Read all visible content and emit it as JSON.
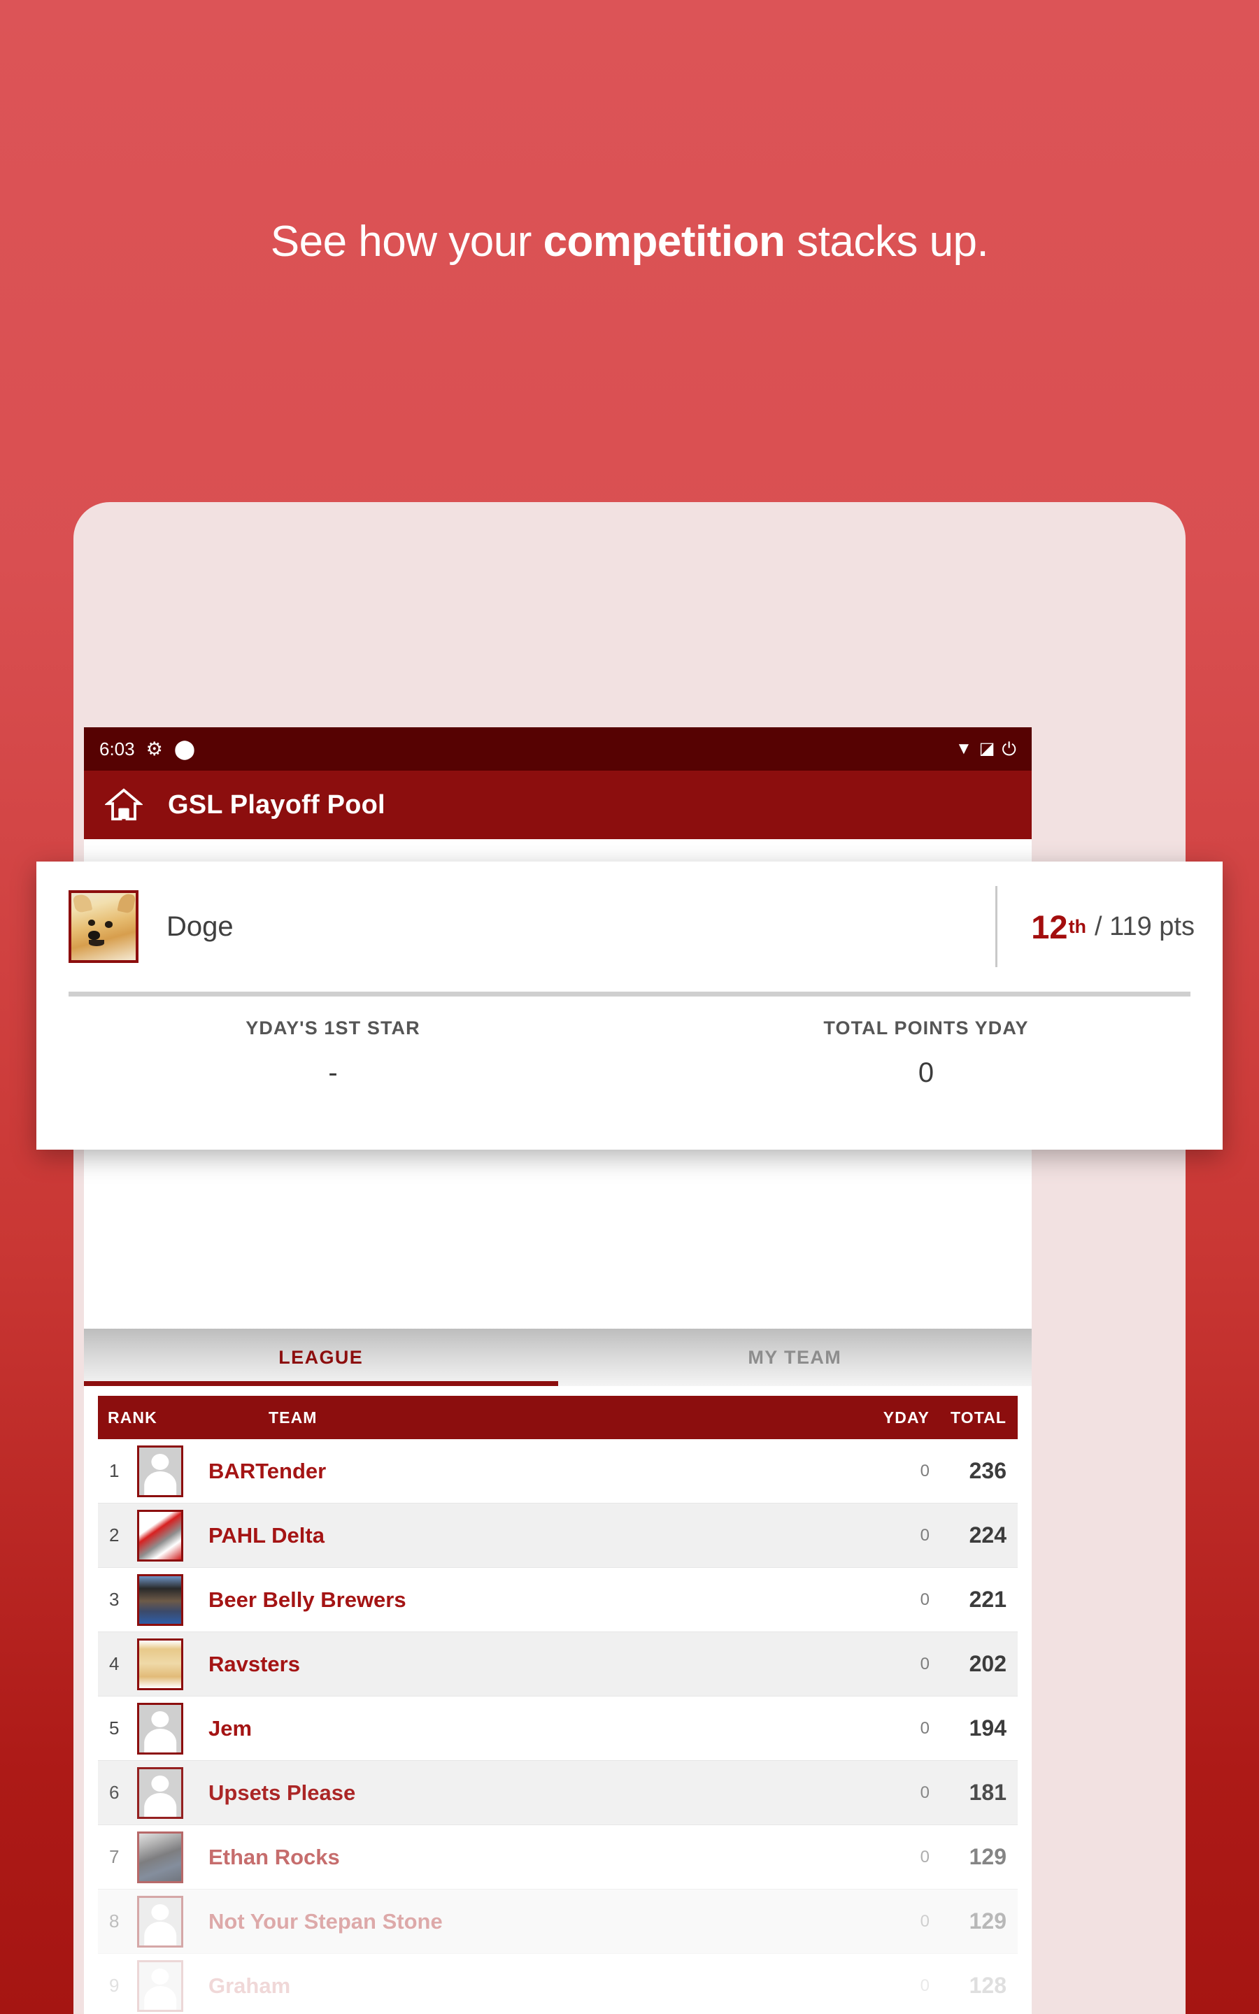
{
  "promo": {
    "headline_prefix": "See how your ",
    "headline_strong": "competition",
    "headline_suffix": " stacks up."
  },
  "status_bar": {
    "time": "6:03",
    "gear_icon": "gear-icon",
    "shield_icon": "shield-icon",
    "wifi_icon": "wifi-icon",
    "signal_icon": "signal-icon",
    "battery_icon": "battery-icon"
  },
  "app_bar": {
    "home_icon": "home-icon",
    "title": "GSL Playoff Pool"
  },
  "tabs": [
    {
      "label": "LEAGUE",
      "active": true
    },
    {
      "label": "MY TEAM",
      "active": false
    }
  ],
  "overlay_card": {
    "avatar_icon": "doge-avatar",
    "team_name": "Doge",
    "rank_number": "12",
    "rank_suffix": "th",
    "points_text": "/ 119 pts",
    "stats": [
      {
        "label": "YDAY'S 1ST STAR",
        "value": "-"
      },
      {
        "label": "TOTAL POINTS YDAY",
        "value": "0"
      }
    ]
  },
  "leaderboard": {
    "columns": {
      "rank": "RANK",
      "team": "TEAM",
      "yday": "YDAY",
      "total": "TOTAL"
    },
    "rows": [
      {
        "rank": "1",
        "team": "BARTender",
        "yday": "0",
        "total": "236"
      },
      {
        "rank": "2",
        "team": "PAHL Delta",
        "yday": "0",
        "total": "224"
      },
      {
        "rank": "3",
        "team": "Beer Belly Brewers",
        "yday": "0",
        "total": "221"
      },
      {
        "rank": "4",
        "team": "Ravsters",
        "yday": "0",
        "total": "202"
      },
      {
        "rank": "5",
        "team": "Jem",
        "yday": "0",
        "total": "194"
      },
      {
        "rank": "6",
        "team": "Upsets Please",
        "yday": "0",
        "total": "181"
      },
      {
        "rank": "7",
        "team": "Ethan Rocks",
        "yday": "0",
        "total": "129"
      },
      {
        "rank": "8",
        "team": "Not Your Stepan Stone",
        "yday": "0",
        "total": "129"
      },
      {
        "rank": "9",
        "team": "Graham",
        "yday": "0",
        "total": "128"
      }
    ]
  },
  "colors": {
    "promo_background_top": "#dc5457",
    "promo_background_bottom": "#a51512",
    "phone_frame": "#f2e1e1",
    "status_bar": "#560202",
    "app_bar": "#8c0e0e",
    "accent_red": "#a41414",
    "tab_active": "#8c0e0e",
    "tab_inactive": "#8d8d8d"
  }
}
